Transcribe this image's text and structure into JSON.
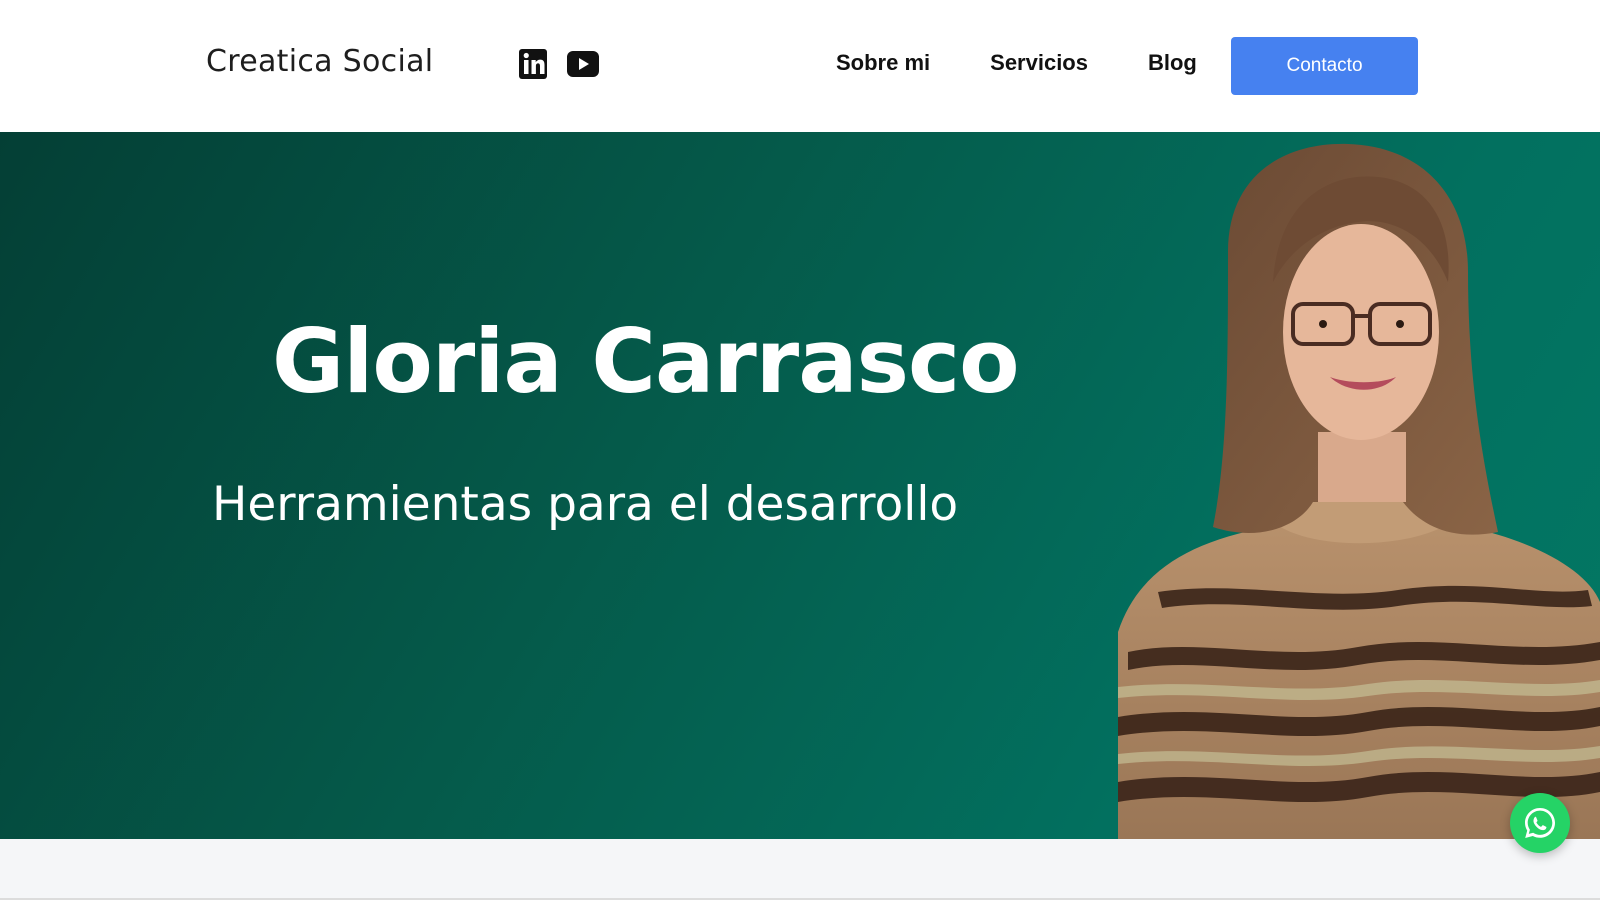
{
  "header": {
    "brand": "Creatica Social",
    "social": [
      {
        "icon": "linkedin-icon"
      },
      {
        "icon": "youtube-icon"
      }
    ],
    "nav": [
      "Sobre mi",
      "Servicios",
      "Blog"
    ],
    "cta_label": "Contacto"
  },
  "hero": {
    "title": "Gloria Carrasco",
    "subtitle": "Herramientas para el desarrollo"
  },
  "floating": {
    "icon": "whatsapp-icon"
  },
  "colors": {
    "accent": "#4681f0",
    "hero_dark": "#043f35",
    "hero_light": "#037864",
    "whatsapp": "#25d366"
  }
}
